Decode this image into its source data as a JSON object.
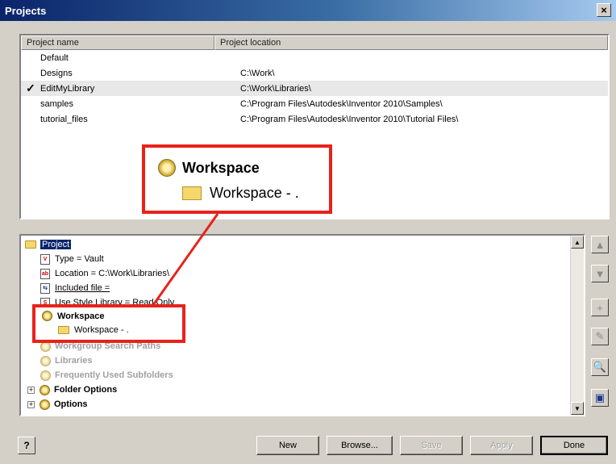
{
  "window": {
    "title": "Projects",
    "close_label": "×"
  },
  "table": {
    "columns": [
      "Project name",
      "Project location"
    ],
    "rows": [
      {
        "name": "Default",
        "location": "",
        "checked": false
      },
      {
        "name": "Designs",
        "location": "C:\\Work\\",
        "checked": false
      },
      {
        "name": "EditMyLibrary",
        "location": "C:\\Work\\Libraries\\",
        "checked": true
      },
      {
        "name": "samples",
        "location": "C:\\Program Files\\Autodesk\\Inventor 2010\\Samples\\",
        "checked": false
      },
      {
        "name": "tutorial_files",
        "location": "C:\\Program Files\\Autodesk\\Inventor 2010\\Tutorial Files\\",
        "checked": false
      }
    ],
    "check_mark": "✓"
  },
  "tree": {
    "root": "Project",
    "type": "Type = Vault",
    "location": "Location = C:\\Work\\Libraries\\",
    "included": "Included file =",
    "use_style": "Use Style Library = Read Only",
    "workspace": "Workspace",
    "workspace_child": "Workspace - .",
    "workgroup": "Workgroup Search Paths",
    "libraries": "Libraries",
    "freq": "Frequently Used Subfolders",
    "folder_options": "Folder Options",
    "options": "Options",
    "expander": "+"
  },
  "callout": {
    "title": "Workspace",
    "child": "Workspace - ."
  },
  "buttons": {
    "help": "?",
    "new": "New",
    "browse": "Browse...",
    "save": "Save",
    "apply": "Apply",
    "done": "Done"
  },
  "side_buttons": {
    "up": "▲",
    "down": "▼",
    "add": "+",
    "edit": "✎",
    "find": "🔍",
    "properties": "▣"
  },
  "colors": {
    "highlight": "#e8221b",
    "selection": "#0a246a"
  }
}
